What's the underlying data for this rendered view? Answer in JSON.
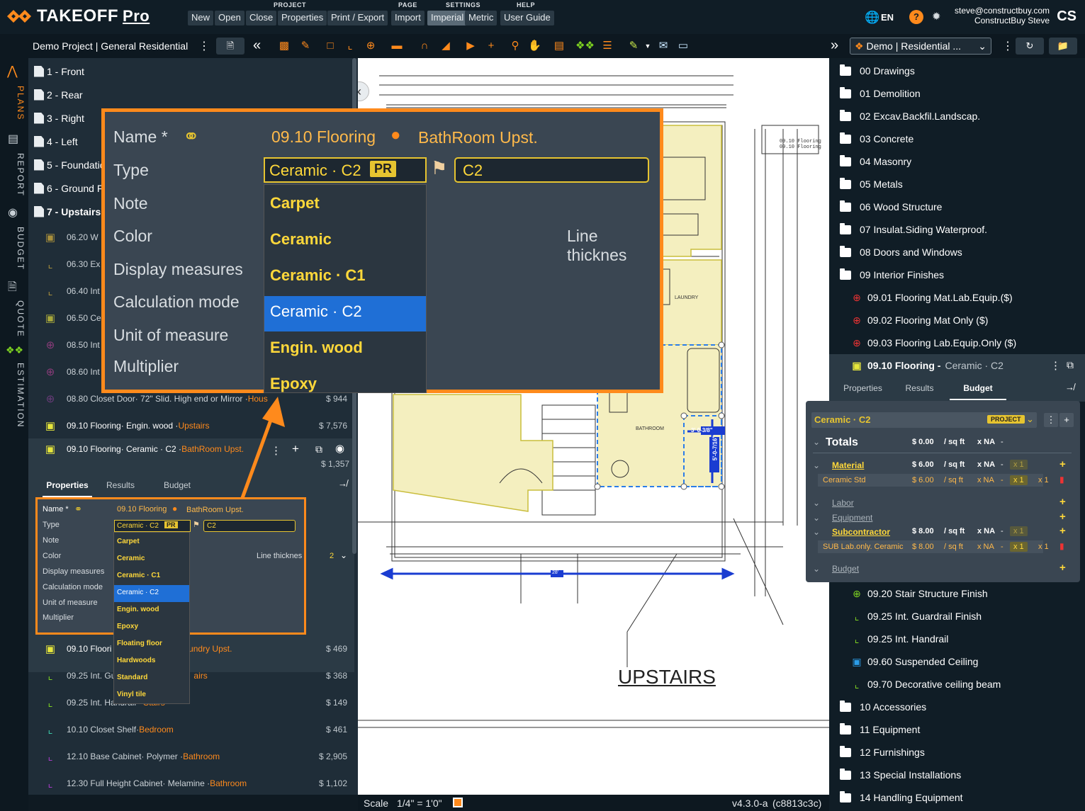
{
  "app": {
    "logo_main": "TAKEOFF",
    "logo_pro": "Pro"
  },
  "menu": {
    "groups": [
      "PROJECT",
      "PAGE",
      "SETTINGS",
      "HELP"
    ],
    "project": [
      "New",
      "Open",
      "Close",
      "Properties",
      "Print / Export"
    ],
    "page": [
      "Import"
    ],
    "settings": [
      "Imperial",
      "Metric"
    ],
    "help": [
      "User Guide"
    ]
  },
  "user": {
    "lang": "EN",
    "email": "steve@constructbuy.com",
    "name": "ConstructBuy Steve",
    "initials": "CS"
  },
  "project_title": "Demo Project | General Residential",
  "project_select": "Demo | Residential ...",
  "rail": [
    "PLANS",
    "REPORT",
    "BUDGET",
    "QUOTE",
    "ESTIMATION"
  ],
  "pages": [
    "1 - Front",
    "2 - Rear",
    "3 - Right",
    "4 - Left",
    "5 - Foundatio",
    "6 - Ground Fl",
    "7 - Upstairs"
  ],
  "items": [
    {
      "name": "06.20 W",
      "detail": "",
      "loc": "",
      "amount": ""
    },
    {
      "name": "06.30 Ex",
      "detail": "",
      "loc": "",
      "amount": ""
    },
    {
      "name": "06.40 Int",
      "detail": "",
      "loc": "",
      "amount": ""
    },
    {
      "name": "06.50 Ce",
      "detail": "",
      "loc": "",
      "amount": ""
    },
    {
      "name": "08.50 Int",
      "detail": "",
      "loc": "",
      "amount": ""
    },
    {
      "name": "08.60 Int",
      "detail": "",
      "loc": "",
      "amount": ""
    },
    {
      "name": "08.80 Closet Door",
      "detail": " · 72\" Slid. High end or Mirror · ",
      "loc": "Hous",
      "amount": "$ 944"
    },
    {
      "name": "09.10 Flooring",
      "detail": " · Engin. wood · ",
      "loc": "Upstairs",
      "amount": "$ 7,576"
    },
    {
      "name": "09.10 Flooring",
      "detail": " · Ceramic · C2 · ",
      "loc": "BathRoom Upst.",
      "amount": "$ 1,357"
    }
  ],
  "items_below": [
    {
      "name": "09.10 Floori",
      "detail": "",
      "loc": "aundry Upst.",
      "amount": "$ 469"
    },
    {
      "name": "09.25 Int. Gu",
      "detail": "",
      "loc": "airs",
      "amount": "$ 368"
    },
    {
      "name": "09.25 Int. Handrail",
      "detail": "",
      "loc": "Stairs",
      "amount": "$ 149"
    },
    {
      "name": "10.10 Closet Shelf",
      "detail": " · ",
      "loc": "Bedroom",
      "amount": "$ 461"
    },
    {
      "name": "12.10 Base Cabinet",
      "detail": " · Polymer · ",
      "loc": "Bathroom",
      "amount": "$ 2,905"
    },
    {
      "name": "12.30 Full Height Cabinet",
      "detail": " · Melamine · ",
      "loc": "Bathroom",
      "amount": "$ 1,102"
    }
  ],
  "props_tabs": [
    "Properties",
    "Results",
    "Budget"
  ],
  "props": {
    "labels": [
      "Name *",
      "Type",
      "Note",
      "Color",
      "Display measures",
      "Calculation mode",
      "Unit of measure",
      "Multiplier"
    ],
    "name_value": "09.10 Flooring",
    "location": "BathRoom Upst.",
    "type_value": "Ceramic · C2",
    "type_badge": "PR",
    "tag_value": "C2",
    "line_thickness_label": "Line thicknes",
    "line_thickness_zoom": "Line thicknes",
    "line_thickness_value": "2",
    "options": [
      "Carpet",
      "Ceramic",
      "Ceramic · C1",
      "Ceramic · C2",
      "Engin. wood",
      "Epoxy",
      "Floating floor",
      "Hardwoods",
      "Standard",
      "Vinyl tile"
    ],
    "selected": "Ceramic · C2"
  },
  "plan": {
    "title": "UPSTAIRS",
    "dim_28": "28'",
    "room_bath": "BATHROOM",
    "room_laundry": "LAUNDRY",
    "dim_a": "3' 0-3/8\"",
    "dim_b": "5'-0-7/16\"",
    "note1": "09.10 Flooring",
    "note2": "09.10 Flooring"
  },
  "status": {
    "scale_label": "Scale",
    "scale_value": "1/4\" = 1'0\"",
    "version": "v4.3.0-a",
    "build": "(c8813c3c)"
  },
  "folders_top": [
    "00 Drawings",
    "01 Demolition",
    "02 Excav.Backfil.Landscap.",
    "03 Concrete",
    "04 Masonry",
    "05 Metals",
    "06 Wood Structure",
    "07 Insulat.Siding Waterproof.",
    "08 Doors and Windows",
    "09 Interior Finishes"
  ],
  "sub_items": [
    "09.01 Flooring Mat.Lab.Equip.($)",
    "09.02 Flooring Mat Only ($)",
    "09.03 Flooring Lab.Equip.Only ($)"
  ],
  "sel_item": {
    "name": "09.10 Flooring -",
    "type": "Ceramic · C2"
  },
  "right_tabs": [
    "Properties",
    "Results",
    "Budget"
  ],
  "budget": {
    "type": "Ceramic · C2",
    "badge": "PROJECT",
    "totals": "Totals",
    "tot_amt": "$ 0.00",
    "unit": "/ sq ft",
    "xna": "x NA",
    "dash": "-",
    "material": "Material",
    "mat_amt": "$ 6.00",
    "ceramic_std": "Ceramic Std",
    "cs_amt": "$ 6.00",
    "labor": "Labor",
    "equipment": "Equipment",
    "subcontractor": "Subcontractor",
    "sub_amt": "$ 8.00",
    "sub_line": "SUB Lab.only. Ceramic",
    "sl_amt": "$ 8.00",
    "budget": "Budget",
    "x1": "x 1"
  },
  "sub_items2": [
    "09.20 Stair Structure Finish",
    "09.25 Int. Guardrail Finish",
    "09.25 Int. Handrail",
    "09.60 Suspended Ceiling",
    "09.70 Decorative ceiling beam"
  ],
  "folders_bottom": [
    "10 Accessories",
    "11 Equipment",
    "12 Furnishings",
    "13 Special Installations",
    "14 Handling Equipment"
  ]
}
